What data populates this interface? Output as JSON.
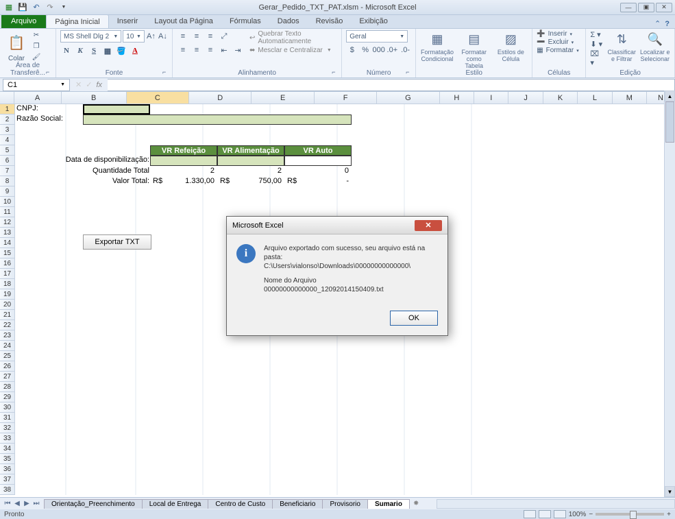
{
  "titlebar": {
    "title": "Gerar_Pedido_TXT_PAT.xlsm - Microsoft Excel"
  },
  "ribbonTabs": {
    "file": "Arquivo",
    "tabs": [
      "Página Inicial",
      "Inserir",
      "Layout da Página",
      "Fórmulas",
      "Dados",
      "Revisão",
      "Exibição"
    ],
    "activeIndex": 0
  },
  "ribbon": {
    "clipboard": {
      "paste": "Colar",
      "groupLabel": "Área de Transferê..."
    },
    "font": {
      "name": "MS Shell Dlg 2",
      "size": "10",
      "groupLabel": "Fonte"
    },
    "alignment": {
      "wrap": "Quebrar Texto Automaticamente",
      "merge": "Mesclar e Centralizar",
      "groupLabel": "Alinhamento"
    },
    "number": {
      "format": "Geral",
      "groupLabel": "Número"
    },
    "styles": {
      "conditional": "Formatação Condicional",
      "table": "Formatar como Tabela",
      "cell": "Estilos de Célula",
      "groupLabel": "Estilo"
    },
    "cells": {
      "insert": "Inserir",
      "delete": "Excluir",
      "format": "Formatar",
      "groupLabel": "Células"
    },
    "editing": {
      "sort": "Classificar e Filtrar",
      "find": "Localizar e Selecionar",
      "groupLabel": "Edição"
    }
  },
  "nameBox": {
    "ref": "C1"
  },
  "colHeaders": [
    "A",
    "B",
    "C",
    "D",
    "E",
    "F",
    "G",
    "H",
    "I",
    "J",
    "K",
    "L",
    "M",
    "N"
  ],
  "sheet": {
    "cnpj_label": "CNPJ:",
    "razao_label": "Razão Social:",
    "headers": {
      "ref": "VR Refeição",
      "alim": "VR Alimentação",
      "auto": "VR Auto"
    },
    "data_label": "Data de disponibilização:",
    "qtd_label": "Quantidade Total",
    "qtd": {
      "d": "2",
      "e": "2",
      "f": "0"
    },
    "valor_label": "Valor Total:",
    "valor": {
      "c_pfx": "R$",
      "c_val": "1.330,00",
      "d_pfx": "R$",
      "d_val": "750,00",
      "e_pfx": "R$",
      "e_val": "-"
    },
    "exportar": "Exportar TXT"
  },
  "dialog": {
    "title": "Microsoft Excel",
    "line1": "Arquivo exportado com sucesso, seu arquivo está na pasta:",
    "line2": "C:\\Users\\vialonso\\Downloads\\00000000000000\\",
    "line3": "Nome do Arquivo",
    "line4": "00000000000000_12092014150409.txt",
    "ok": "OK"
  },
  "sheetTabs": {
    "tabs": [
      "Orientação_Preenchimento",
      "Local de Entrega",
      "Centro de Custo",
      "Beneficiario",
      "Provisorio",
      "Sumario"
    ],
    "activeIndex": 5
  },
  "statusBar": {
    "ready": "Pronto",
    "zoom": "100%"
  }
}
